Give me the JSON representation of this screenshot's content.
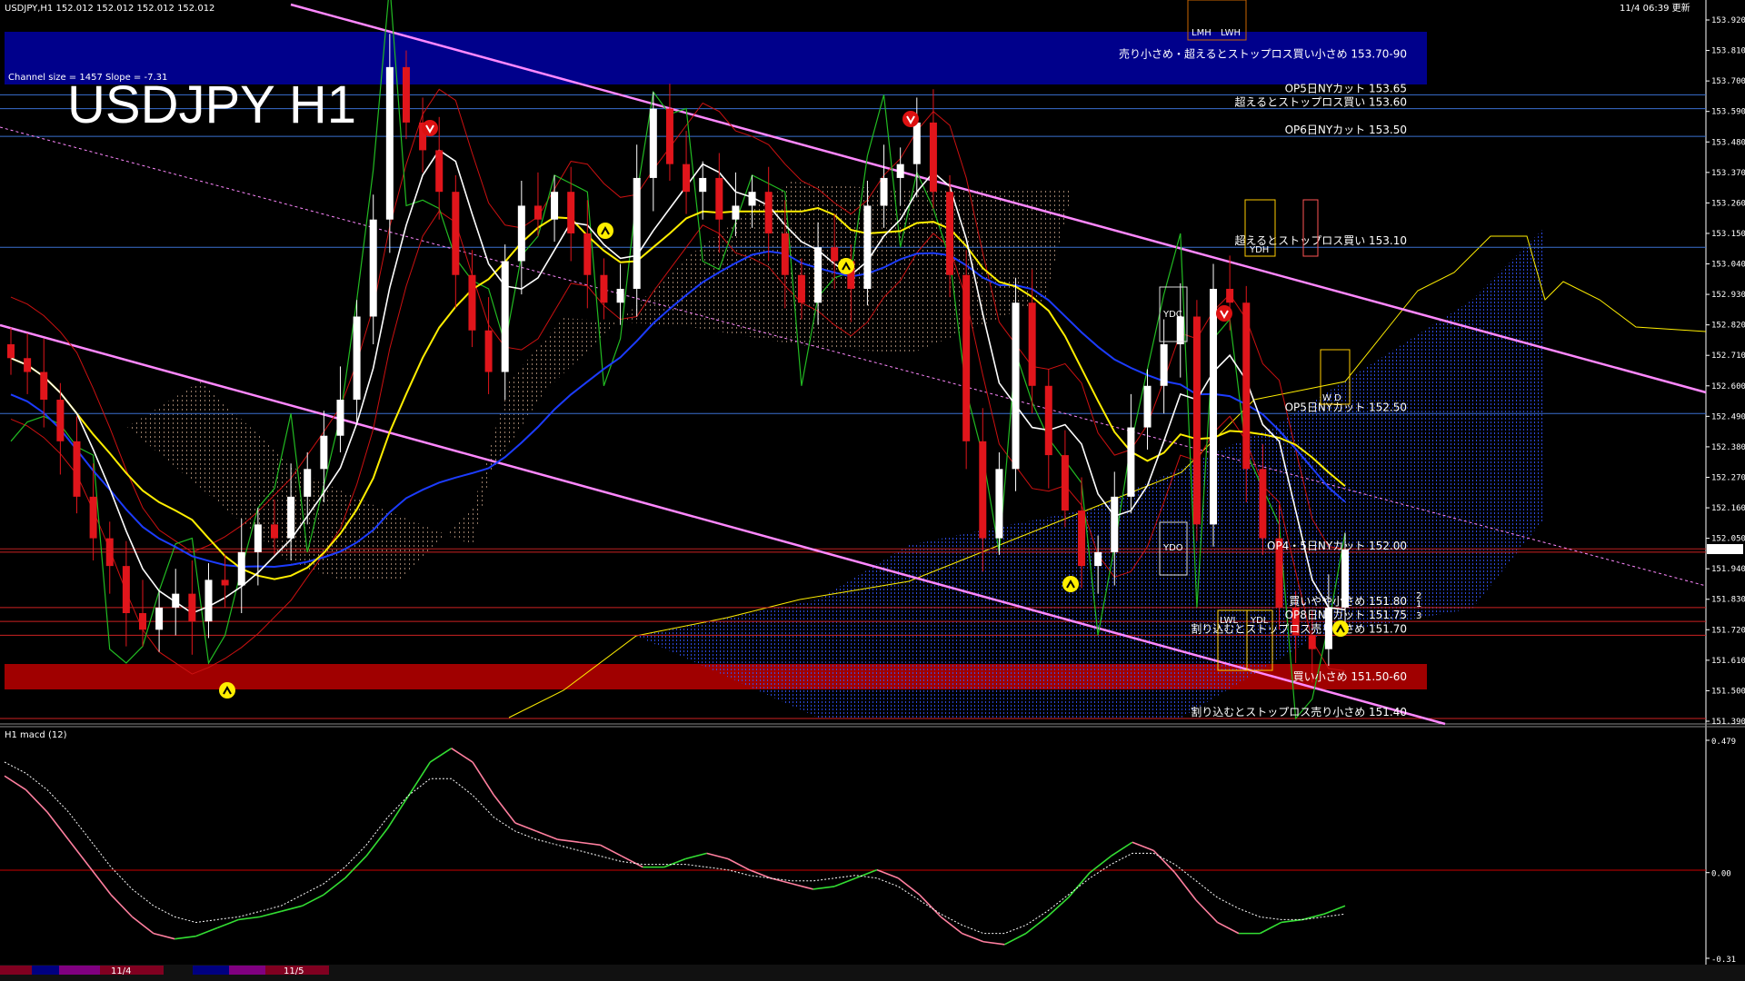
{
  "header": {
    "symbol_info": "USDJPY,H1  152.012 152.012 152.012 152.012",
    "server_time": "11/4 06:39 更新",
    "chart_title": "USDJPY H1",
    "channel_info": "Channel size = 1457 Slope = -7.31",
    "macd_label": "H1  macd (12)"
  },
  "colors": {
    "background": "#000000",
    "bull_candle": "#ffffff",
    "bear_candle": "#e0151b",
    "sell_zone": "#00008b",
    "buy_zone": "#a00000",
    "channel": "#ff88ff",
    "ma_fast": "#ffffff",
    "ma_mid": "#ffee00",
    "ma_slow": "#1c3cff",
    "macd_up": "#33dd33",
    "macd_down": "#ff7f9f",
    "signal": "#ffffff"
  },
  "markers": {
    "lmh": "LMH",
    "lwh": "LWH",
    "ydc": "YDC",
    "ydh": "YDH",
    "ydo": "YDO",
    "ydl": "YDL",
    "lwl": "LWL",
    "wd": "W D",
    "n1": "1",
    "n2": "2",
    "n3": "3"
  },
  "chart_data": {
    "type": "candlestick",
    "timeframe": "H1",
    "ylim": [
      151.39,
      153.92
    ],
    "current_price": 152.012,
    "y_ticks": [
      "153.920",
      "153.810",
      "153.700",
      "153.590",
      "153.480",
      "153.370",
      "153.260",
      "153.150",
      "153.040",
      "152.930",
      "152.820",
      "152.710",
      "152.600",
      "152.490",
      "152.380",
      "152.270",
      "152.160",
      "152.050",
      "151.940",
      "151.830",
      "151.720",
      "151.610",
      "151.500",
      "151.390"
    ],
    "x_labels": [
      "11/4",
      "11/5"
    ],
    "closes": [
      152.7,
      152.65,
      152.55,
      152.4,
      152.2,
      152.05,
      151.95,
      151.78,
      151.72,
      151.8,
      151.85,
      151.75,
      151.9,
      151.88,
      152.0,
      152.1,
      152.05,
      152.2,
      152.3,
      152.42,
      152.55,
      152.85,
      153.2,
      153.75,
      153.55,
      153.45,
      153.3,
      153.0,
      152.8,
      152.65,
      153.05,
      153.25,
      153.2,
      153.3,
      153.15,
      153.0,
      152.9,
      152.95,
      153.35,
      153.6,
      153.4,
      153.3,
      153.35,
      153.2,
      153.25,
      153.3,
      153.15,
      153.0,
      152.9,
      153.1,
      153.05,
      152.95,
      153.25,
      153.35,
      153.4,
      153.55,
      153.3,
      153.0,
      152.4,
      152.05,
      152.3,
      152.9,
      152.6,
      152.35,
      152.15,
      151.95,
      152.0,
      152.2,
      152.45,
      152.6,
      152.75,
      152.85,
      152.1,
      152.95,
      152.9,
      152.3,
      152.05,
      151.8,
      151.7,
      151.65,
      151.8,
      152.01
    ],
    "levels": [
      {
        "label": "売り小さめ・超えるとストップロス買い小さめ 153.70-90",
        "price": 153.8
      },
      {
        "label": "OP5日NYカット 153.65",
        "price": 153.65
      },
      {
        "label": "超えるとストップロス買い 153.60",
        "price": 153.6
      },
      {
        "label": "OP6日NYカット 153.50",
        "price": 153.5
      },
      {
        "label": "超えるとストップロス買い 153.10",
        "price": 153.1
      },
      {
        "label": "OP5日NYカット 152.50",
        "price": 152.5
      },
      {
        "label": "OP4・5日NYカット 152.00",
        "price": 152.0
      },
      {
        "label": "買いやや小さめ 151.80",
        "price": 151.8
      },
      {
        "label": "OP8日NYカット 151.75",
        "price": 151.75
      },
      {
        "label": "割り込むとストップロス売り小さめ 151.70",
        "price": 151.7
      },
      {
        "label": "買い小さめ 151.50-60",
        "price": 151.55
      },
      {
        "label": "割り込むとストップロス売り小さめ 151.40",
        "price": 151.4
      }
    ],
    "macd": {
      "ylim": [
        -0.31,
        0.479
      ],
      "ticks": [
        "0.479",
        "0.00",
        "-0.31"
      ],
      "main": [
        0.35,
        0.3,
        0.22,
        0.12,
        0.02,
        -0.08,
        -0.16,
        -0.22,
        -0.24,
        -0.23,
        -0.2,
        -0.17,
        -0.16,
        -0.14,
        -0.12,
        -0.08,
        -0.02,
        0.06,
        0.16,
        0.28,
        0.4,
        0.45,
        0.4,
        0.28,
        0.18,
        0.15,
        0.12,
        0.11,
        0.1,
        0.06,
        0.02,
        0.02,
        0.05,
        0.07,
        0.05,
        0.01,
        -0.02,
        -0.04,
        -0.06,
        -0.05,
        -0.02,
        0.01,
        -0.02,
        -0.08,
        -0.16,
        -0.22,
        -0.25,
        -0.26,
        -0.22,
        -0.16,
        -0.09,
        0.0,
        0.06,
        0.11,
        0.08,
        0.0,
        -0.1,
        -0.18,
        -0.22,
        -0.22,
        -0.18,
        -0.17,
        -0.15,
        -0.12
      ],
      "signal": [
        0.4,
        0.36,
        0.3,
        0.22,
        0.12,
        0.02,
        -0.06,
        -0.12,
        -0.16,
        -0.18,
        -0.17,
        -0.16,
        -0.14,
        -0.12,
        -0.08,
        -0.04,
        0.02,
        0.1,
        0.2,
        0.28,
        0.34,
        0.34,
        0.28,
        0.2,
        0.15,
        0.12,
        0.1,
        0.08,
        0.06,
        0.04,
        0.03,
        0.03,
        0.03,
        0.02,
        0.01,
        -0.01,
        -0.02,
        -0.03,
        -0.03,
        -0.02,
        -0.01,
        -0.02,
        -0.05,
        -0.1,
        -0.15,
        -0.19,
        -0.22,
        -0.22,
        -0.19,
        -0.14,
        -0.08,
        -0.02,
        0.03,
        0.07,
        0.07,
        0.03,
        -0.03,
        -0.09,
        -0.13,
        -0.16,
        -0.17,
        -0.17,
        -0.16,
        -0.15
      ]
    }
  }
}
